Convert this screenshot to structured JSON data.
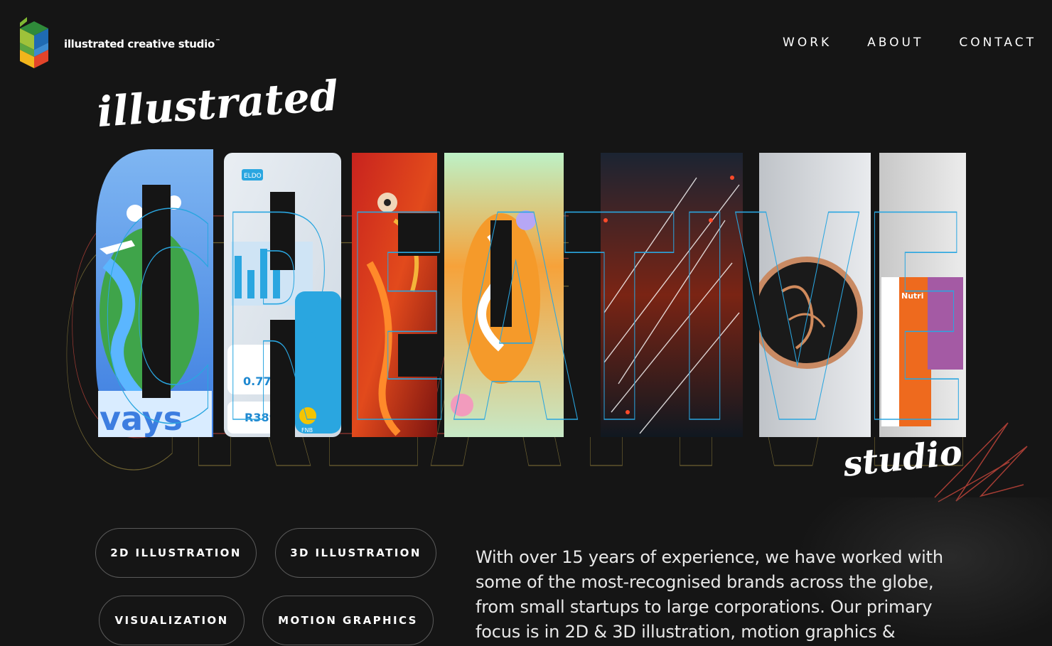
{
  "header": {
    "brand": "illustrated creative studio",
    "trademark": "™",
    "nav": [
      {
        "label": "WORK"
      },
      {
        "label": "ABOUT"
      },
      {
        "label": "CONTACT"
      }
    ]
  },
  "hero": {
    "script_top": "illustrated",
    "headline": "CREATIVE",
    "script_bottom": "studio",
    "tile_texts": [
      "ELDO",
      "0.77k",
      "R389",
      "FNB",
      "Nutri"
    ]
  },
  "services": [
    {
      "label": "2D ILLUSTRATION"
    },
    {
      "label": "3D ILLUSTRATION"
    },
    {
      "label": "VISUALIZATION"
    },
    {
      "label": "MOTION GRAPHICS"
    }
  ],
  "about": {
    "text": "With over 15 years of experience, we have worked with some of the most-recognised brands across the globe, from small startups to large corporations. Our primary focus is in 2D & 3D illustration, motion graphics &"
  },
  "colors": {
    "background": "#151515",
    "outline_blue": "#2aa6e0",
    "outline_red": "#c0443a",
    "outline_olive": "#8a7a3a"
  }
}
